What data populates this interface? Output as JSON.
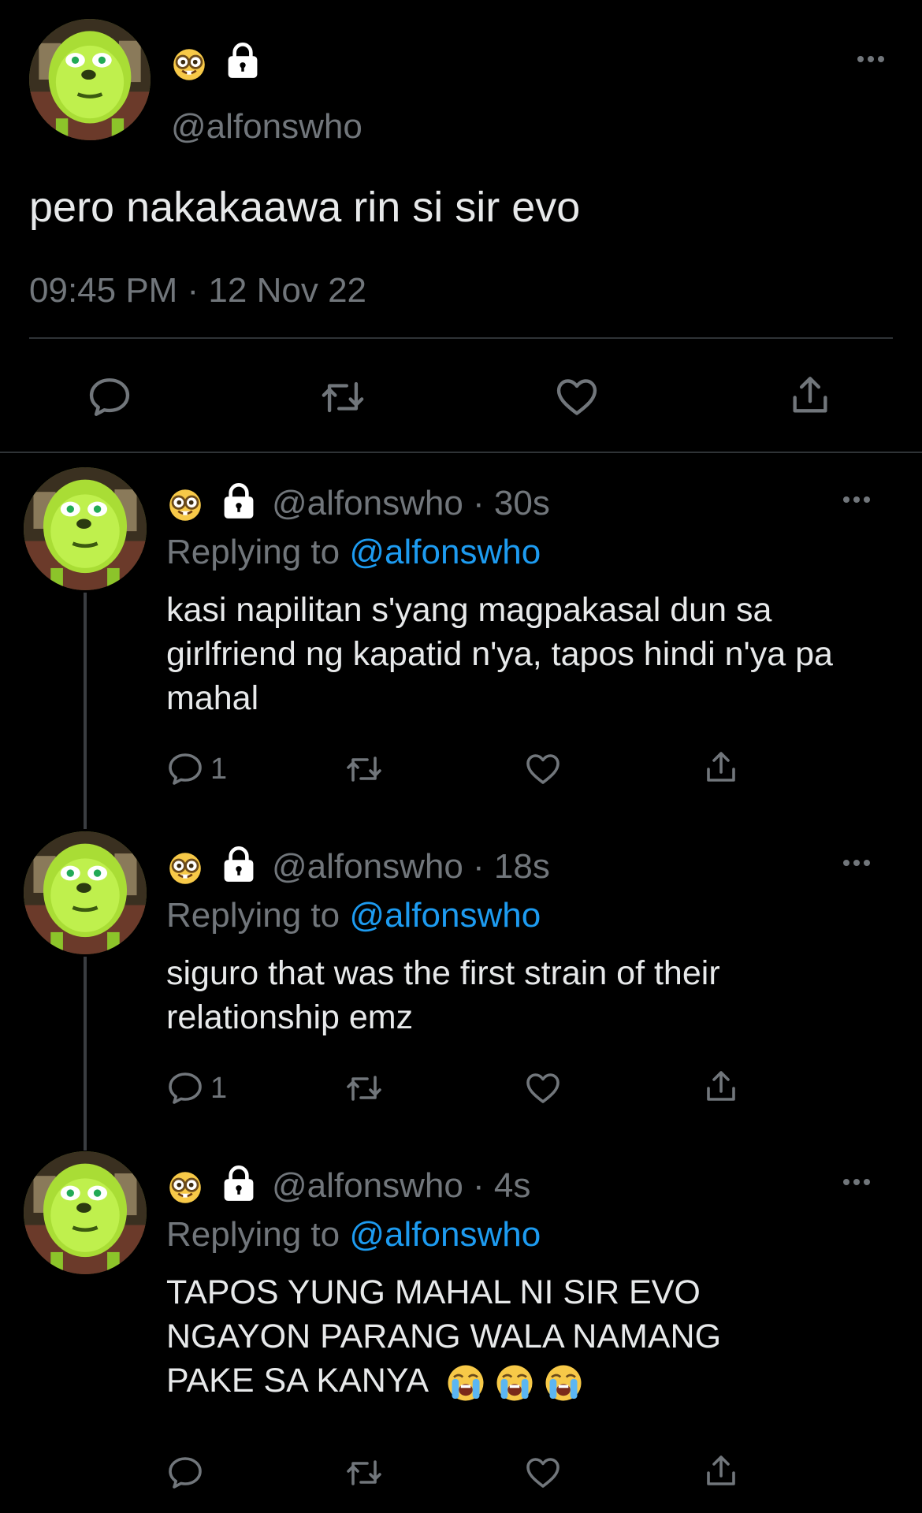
{
  "main_tweet": {
    "handle": "@alfonswho",
    "text": "pero nakakaawa rin si sir evo",
    "timestamp": "09:45 PM · 12 Nov 22"
  },
  "replies": [
    {
      "handle": "@alfonswho",
      "time": "· 30s",
      "replying_label": "Replying to",
      "replying_to": "@alfonswho",
      "text": "kasi napilitan s'yang magpakasal dun sa girlfriend ng kapatid n'ya, tapos hindi n'ya pa mahal",
      "reply_count": "1"
    },
    {
      "handle": "@alfonswho",
      "time": "· 18s",
      "replying_label": "Replying to",
      "replying_to": "@alfonswho",
      "text": "siguro that was the first strain of their relationship emz",
      "reply_count": "1"
    },
    {
      "handle": "@alfonswho",
      "time": "· 4s",
      "replying_label": "Replying to",
      "replying_to": "@alfonswho",
      "text": "TAPOS YUNG MAHAL NI SIR EVO NGAYON PARANG WALA NAMANG PAKE SA KANYA",
      "reply_count": ""
    }
  ],
  "colors": {
    "background": "#000000",
    "text": "#e7e9ea",
    "muted": "#71767b",
    "link": "#1d9bf0"
  },
  "icons": [
    "nerd-face-emoji",
    "lock-icon",
    "more-icon",
    "reply-icon",
    "retweet-icon",
    "like-icon",
    "share-icon",
    "loudly-crying-emoji"
  ]
}
